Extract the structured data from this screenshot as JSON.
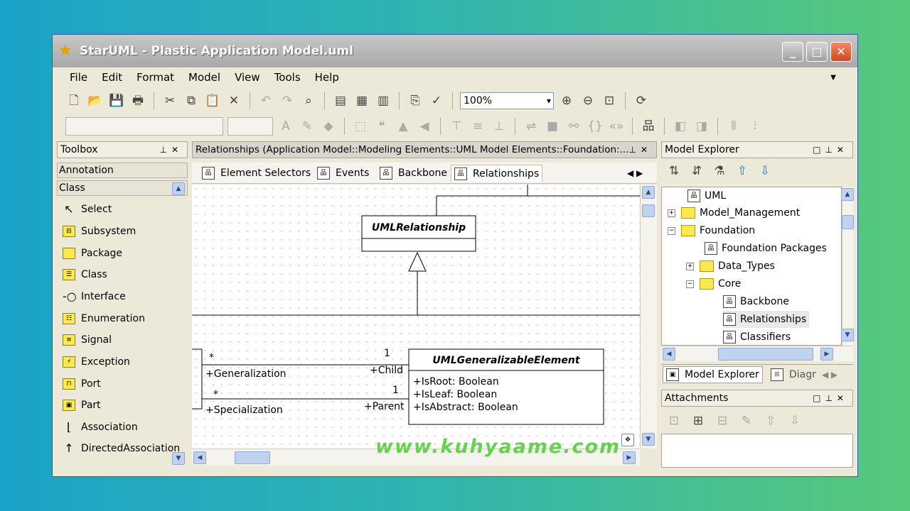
{
  "window": {
    "title": "StarUML - Plastic Application Model.uml"
  },
  "menu": [
    "File",
    "Edit",
    "Format",
    "Model",
    "View",
    "Tools",
    "Help"
  ],
  "toolbar": {
    "zoom": "100%"
  },
  "toolbox": {
    "title": "Toolbox",
    "groups": [
      "Annotation",
      "Class"
    ],
    "tools": [
      "Select",
      "Subsystem",
      "Package",
      "Class",
      "Interface",
      "Enumeration",
      "Signal",
      "Exception",
      "Port",
      "Part",
      "Association",
      "DirectedAssociation"
    ]
  },
  "editor": {
    "title": "Relationships (Application Model::Modeling Elements::UML Model Elements::Foundation:...",
    "tabs": [
      "Element Selectors",
      "Events",
      "Backbone",
      "Relationships"
    ],
    "active_tab": "Relationships"
  },
  "diagram": {
    "class_relationship": "UMLRelationship",
    "class_generalizable": "UMLGeneralizableElement",
    "attributes": [
      "+IsRoot: Boolean",
      "+IsLeaf: Boolean",
      "+IsAbstract: Boolean"
    ],
    "assoc1": {
      "left_mult": "*",
      "left_role": "+Generalization",
      "right_mult": "1",
      "right_role": "+Child"
    },
    "assoc2": {
      "left_mult": "*",
      "left_role": "+Specialization",
      "right_mult": "1",
      "right_role": "+Parent"
    }
  },
  "model_explorer": {
    "title": "Model Explorer",
    "nodes": [
      {
        "label": "UML",
        "kind": "diagram"
      },
      {
        "label": "Model_Management",
        "kind": "folder"
      },
      {
        "label": "Foundation",
        "kind": "folder"
      },
      {
        "label": "Foundation Packages",
        "kind": "diagram"
      },
      {
        "label": "Data_Types",
        "kind": "folder"
      },
      {
        "label": "Core",
        "kind": "folder"
      },
      {
        "label": "Backbone",
        "kind": "diagram"
      },
      {
        "label": "Relationships",
        "kind": "diagram"
      },
      {
        "label": "Classifiers",
        "kind": "diagram"
      }
    ],
    "bottom_tabs": [
      "Model Explorer",
      "Diagr"
    ]
  },
  "attachments": {
    "title": "Attachments"
  },
  "watermark": "www.kuhyaame.com"
}
